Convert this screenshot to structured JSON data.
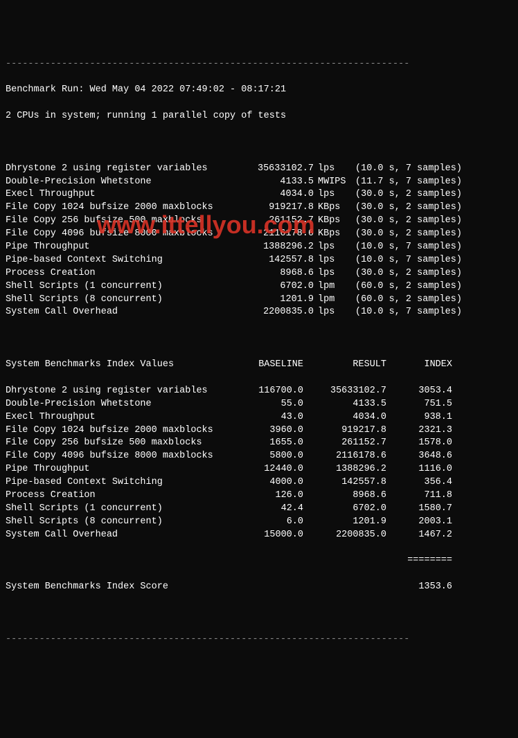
{
  "dash": "------------------------------------------------------------------------",
  "header": {
    "run": "Benchmark Run: Wed May 04 2022 07:49:02 - 08:17:21",
    "cpus": "2 CPUs in system; running 1 parallel copy of tests"
  },
  "results": [
    {
      "name": "Dhrystone 2 using register variables",
      "value": "35633102.7",
      "unit": "lps",
      "timing": "(10.0 s, 7 samples)"
    },
    {
      "name": "Double-Precision Whetstone",
      "value": "4133.5",
      "unit": "MWIPS",
      "timing": "(11.7 s, 7 samples)"
    },
    {
      "name": "Execl Throughput",
      "value": "4034.0",
      "unit": "lps",
      "timing": "(30.0 s, 2 samples)"
    },
    {
      "name": "File Copy 1024 bufsize 2000 maxblocks",
      "value": "919217.8",
      "unit": "KBps",
      "timing": "(30.0 s, 2 samples)"
    },
    {
      "name": "File Copy 256 bufsize 500 maxblocks",
      "value": "261152.7",
      "unit": "KBps",
      "timing": "(30.0 s, 2 samples)"
    },
    {
      "name": "File Copy 4096 bufsize 8000 maxblocks",
      "value": "2116178.6",
      "unit": "KBps",
      "timing": "(30.0 s, 2 samples)"
    },
    {
      "name": "Pipe Throughput",
      "value": "1388296.2",
      "unit": "lps",
      "timing": "(10.0 s, 7 samples)"
    },
    {
      "name": "Pipe-based Context Switching",
      "value": "142557.8",
      "unit": "lps",
      "timing": "(10.0 s, 7 samples)"
    },
    {
      "name": "Process Creation",
      "value": "8968.6",
      "unit": "lps",
      "timing": "(30.0 s, 2 samples)"
    },
    {
      "name": "Shell Scripts (1 concurrent)",
      "value": "6702.0",
      "unit": "lpm",
      "timing": "(60.0 s, 2 samples)"
    },
    {
      "name": "Shell Scripts (8 concurrent)",
      "value": "1201.9",
      "unit": "lpm",
      "timing": "(60.0 s, 2 samples)"
    },
    {
      "name": "System Call Overhead",
      "value": "2200835.0",
      "unit": "lps",
      "timing": "(10.0 s, 7 samples)"
    }
  ],
  "index_header": {
    "label": "System Benchmarks Index Values",
    "baseline": "BASELINE",
    "result": "RESULT",
    "index": "INDEX"
  },
  "indices": [
    {
      "name": "Dhrystone 2 using register variables",
      "baseline": "116700.0",
      "result": "35633102.7",
      "index": "3053.4"
    },
    {
      "name": "Double-Precision Whetstone",
      "baseline": "55.0",
      "result": "4133.5",
      "index": "751.5"
    },
    {
      "name": "Execl Throughput",
      "baseline": "43.0",
      "result": "4034.0",
      "index": "938.1"
    },
    {
      "name": "File Copy 1024 bufsize 2000 maxblocks",
      "baseline": "3960.0",
      "result": "919217.8",
      "index": "2321.3"
    },
    {
      "name": "File Copy 256 bufsize 500 maxblocks",
      "baseline": "1655.0",
      "result": "261152.7",
      "index": "1578.0"
    },
    {
      "name": "File Copy 4096 bufsize 8000 maxblocks",
      "baseline": "5800.0",
      "result": "2116178.6",
      "index": "3648.6"
    },
    {
      "name": "Pipe Throughput",
      "baseline": "12440.0",
      "result": "1388296.2",
      "index": "1116.0"
    },
    {
      "name": "Pipe-based Context Switching",
      "baseline": "4000.0",
      "result": "142557.8",
      "index": "356.4"
    },
    {
      "name": "Process Creation",
      "baseline": "126.0",
      "result": "8968.6",
      "index": "711.8"
    },
    {
      "name": "Shell Scripts (1 concurrent)",
      "baseline": "42.4",
      "result": "6702.0",
      "index": "1580.7"
    },
    {
      "name": "Shell Scripts (8 concurrent)",
      "baseline": "6.0",
      "result": "1201.9",
      "index": "2003.1"
    },
    {
      "name": "System Call Overhead",
      "baseline": "15000.0",
      "result": "2200835.0",
      "index": "1467.2"
    }
  ],
  "eq": "========",
  "final_score": {
    "label": "System Benchmarks Index Score",
    "value": "1353.6"
  },
  "watermark": "www.ittellyou.com"
}
